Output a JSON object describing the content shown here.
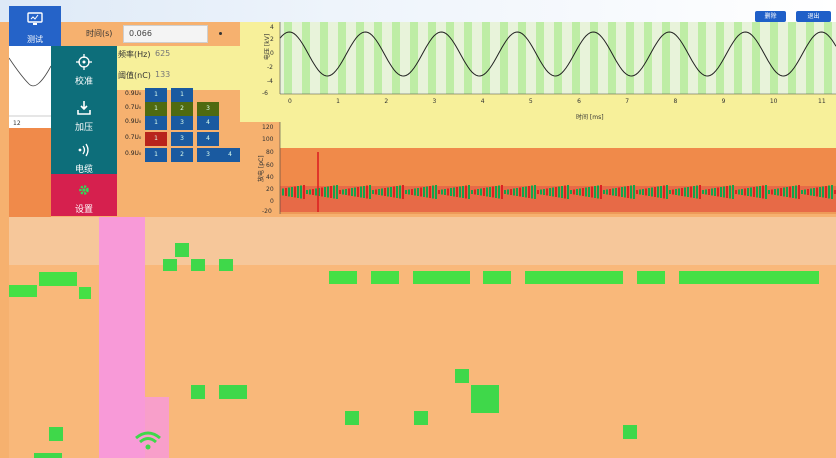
{
  "header": {
    "delete_label": "删除",
    "exit_label": "退出"
  },
  "nav": {
    "test_label": "测试",
    "items": [
      {
        "label": "校准",
        "icon": "crosshair-icon"
      },
      {
        "label": "加压",
        "icon": "download-icon"
      },
      {
        "label": "电缆",
        "icon": "wireless-signal-icon"
      },
      {
        "label": "设置",
        "icon": "gear-icon"
      }
    ]
  },
  "params": {
    "first_label": "时间(s)",
    "first_value": "0.066",
    "freq_label": "频率(Hz)",
    "freq_value": "625",
    "threshold_label": "阈值(nC)",
    "threshold_value": "133"
  },
  "matrix": {
    "rows": [
      {
        "label": "0.9U₀",
        "cells": [
          "1",
          "1",
          "",
          ""
        ]
      },
      {
        "label": "0.7U₀",
        "cells": [
          "1",
          "2",
          "3",
          ""
        ]
      },
      {
        "label": "0.9U₀",
        "cells": [
          "1",
          "3",
          "4",
          ""
        ]
      },
      {
        "label": "0.7U₀",
        "cells": [
          "1",
          "3",
          "4",
          ""
        ]
      },
      {
        "label": "0.9U₀",
        "cells": [
          "1",
          "2",
          "3",
          "4"
        ]
      }
    ]
  },
  "mini_chart": {
    "tick": "12"
  },
  "waveform": {
    "ylabel": "电压 [kV]",
    "yticks": [
      "4",
      "2",
      "0",
      "-2",
      "-4",
      "-6"
    ],
    "xlabel": "时间 [ms]",
    "xticks": [
      "0",
      "1",
      "2",
      "3",
      "4",
      "5",
      "6",
      "7",
      "8",
      "9",
      "10",
      "11"
    ]
  },
  "pd": {
    "ylabel": "放电 [pC]",
    "yticks": [
      "120",
      "100",
      "80",
      "60",
      "40",
      "20",
      "0",
      "-20"
    ]
  },
  "colors": {
    "primary": "#2563c8",
    "teal": "#0d6e7a",
    "active": "#d6204e",
    "accent_green": "#45e045",
    "background": "#f6b16f"
  }
}
